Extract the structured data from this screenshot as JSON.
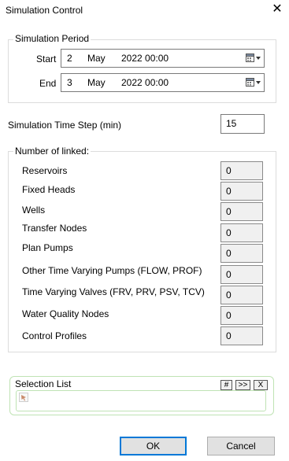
{
  "window": {
    "title": "Simulation Control",
    "close_glyph": "✕"
  },
  "period": {
    "legend": "Simulation Period",
    "start": {
      "label": "Start",
      "day": "2",
      "month": "May",
      "year_time": "2022 00:00"
    },
    "end": {
      "label": "End",
      "day": "3",
      "month": "May",
      "year_time": "2022 00:00"
    },
    "calendar_icon": "calendar-dropdown-icon"
  },
  "timestep": {
    "label": "Simulation Time Step (min)",
    "value": "15"
  },
  "linked": {
    "legend": "Number of linked:",
    "items": [
      {
        "label": "Reservoirs",
        "value": "0"
      },
      {
        "label": "Fixed Heads",
        "value": "0"
      },
      {
        "label": "Wells",
        "value": "0"
      },
      {
        "label": "Transfer Nodes",
        "value": "0"
      },
      {
        "label": "Plan Pumps",
        "value": "0"
      },
      {
        "label": "Other Time Varying Pumps (FLOW, PROF)",
        "value": "0"
      },
      {
        "label": "Time Varying Valves (FRV, PRV, PSV, TCV)",
        "value": "0"
      },
      {
        "label": "Water Quality Nodes",
        "value": "0"
      },
      {
        "label": "Control Profiles",
        "value": "0"
      }
    ]
  },
  "selection": {
    "label": "Selection List",
    "buttons": {
      "hash": "#",
      "next": ">>",
      "clear": "X"
    },
    "item_icon": "cursor-icon"
  },
  "buttons": {
    "ok": "OK",
    "cancel": "Cancel"
  },
  "colors": {
    "accent": "#0078d7",
    "selection_border": "#bfe3b4"
  }
}
